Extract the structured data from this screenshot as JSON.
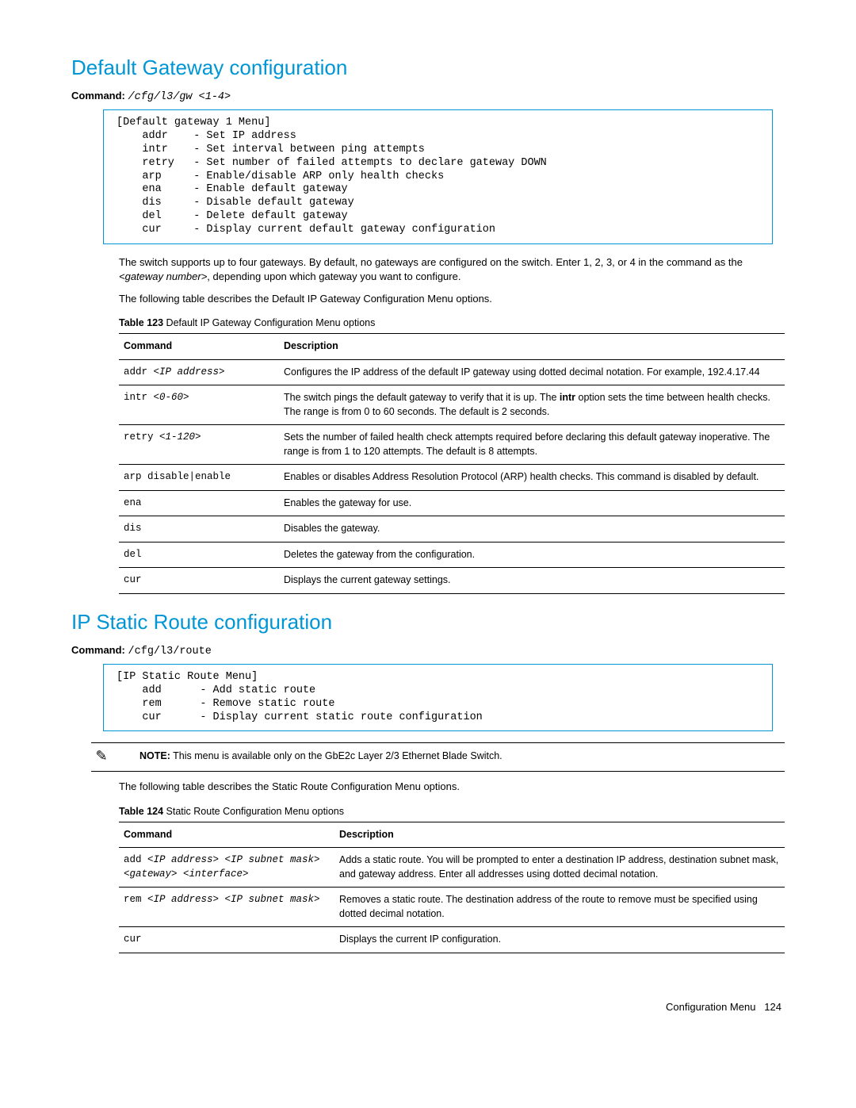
{
  "sections": [
    {
      "title": "Default Gateway configuration",
      "command_label": "Command:",
      "command": "/cfg/l3/gw <1-4>",
      "menu_text": "[Default gateway 1 Menu]\n    addr    - Set IP address\n    intr    - Set interval between ping attempts\n    retry   - Set number of failed attempts to declare gateway DOWN\n    arp     - Enable/disable ARP only health checks\n    ena     - Enable default gateway\n    dis     - Disable default gateway\n    del     - Delete default gateway\n    cur     - Display current default gateway configuration",
      "para1_a": "The switch supports up to four gateways. By default, no gateways are configured on the switch. Enter 1, 2, 3, or 4 in the command as the ",
      "para1_i": "<gateway number>",
      "para1_b": ", depending upon which gateway you want to configure.",
      "para2": "The following table describes the Default IP Gateway Configuration Menu options.",
      "table_caption_bold": "Table 123",
      "table_caption_rest": " Default IP Gateway Configuration Menu options",
      "col_cmd": "Command",
      "col_desc": "Description",
      "rows": [
        {
          "cmd_a": "addr ",
          "cmd_i": "<IP address>",
          "desc": "Configures the IP address of the default IP gateway using dotted decimal notation. For example, 192.4.17.44"
        },
        {
          "cmd_a": "intr ",
          "cmd_i": "<0-60>",
          "desc_a": "The switch pings the default gateway to verify that it is up. The ",
          "desc_b": "intr",
          "desc_c": " option sets the time between health checks. The range is from 0 to 60 seconds. The default is 2 seconds."
        },
        {
          "cmd_a": "retry ",
          "cmd_i": "<1-120>",
          "desc": "Sets the number of failed health check attempts required before declaring this default gateway inoperative. The range is from 1 to 120 attempts. The default is 8 attempts."
        },
        {
          "cmd_a": "arp disable|enable",
          "cmd_i": "",
          "desc": "Enables or disables Address Resolution Protocol (ARP) health checks. This command is disabled by default."
        },
        {
          "cmd_a": "ena",
          "cmd_i": "",
          "desc": "Enables the gateway for use."
        },
        {
          "cmd_a": "dis",
          "cmd_i": "",
          "desc": "Disables the gateway."
        },
        {
          "cmd_a": "del",
          "cmd_i": "",
          "desc": "Deletes the gateway from the configuration."
        },
        {
          "cmd_a": "cur",
          "cmd_i": "",
          "desc": "Displays the current gateway settings."
        }
      ]
    },
    {
      "title": "IP Static Route configuration",
      "command_label": "Command:",
      "command": "/cfg/l3/route",
      "menu_text": "[IP Static Route Menu]\n    add      - Add static route\n    rem      - Remove static route\n    cur      - Display current static route configuration",
      "note_label": "NOTE:",
      "note_text": " This menu is available only on the GbE2c Layer 2/3 Ethernet Blade Switch.",
      "para2": "The following table describes the Static Route Configuration Menu options.",
      "table_caption_bold": "Table 124",
      "table_caption_rest": " Static Route Configuration Menu options",
      "col_cmd": "Command",
      "col_desc": "Description",
      "rows": [
        {
          "cmd_a": "add ",
          "cmd_i": "<IP address> <IP subnet mask> <gateway> <interface>",
          "desc": "Adds a static route. You will be prompted to enter a destination IP address, destination subnet mask, and gateway address. Enter all addresses using dotted decimal notation."
        },
        {
          "cmd_a": "rem ",
          "cmd_i": "<IP address> <IP subnet mask>",
          "desc": "Removes a static route. The destination address of the route to remove must be specified using dotted decimal notation."
        },
        {
          "cmd_a": "cur",
          "cmd_i": "",
          "desc": "Displays the current IP configuration."
        }
      ]
    }
  ],
  "footer_label": "Configuration Menu",
  "footer_page": "124",
  "note_icon": "✎"
}
